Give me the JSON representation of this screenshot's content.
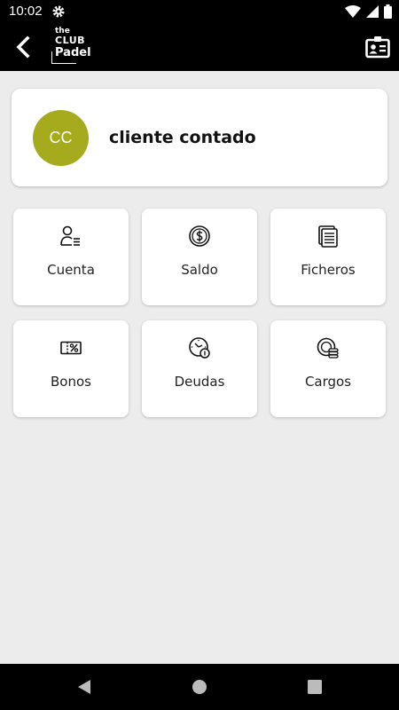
{
  "status_bar": {
    "time": "10:02"
  },
  "app_bar": {
    "logo": {
      "line1": "the",
      "line2": "CLUB",
      "line3": "Padel"
    }
  },
  "profile": {
    "initials": "CC",
    "name": "cliente contado",
    "avatar_color": "#a5ab1c"
  },
  "tiles": [
    {
      "label": "Cuenta",
      "icon": "user-list-icon"
    },
    {
      "label": "Saldo",
      "icon": "dollar-coin-icon"
    },
    {
      "label": "Ficheros",
      "icon": "documents-icon"
    },
    {
      "label": "Bonos",
      "icon": "ticket-percent-icon"
    },
    {
      "label": "Deudas",
      "icon": "clock-coin-icon"
    },
    {
      "label": "Cargos",
      "icon": "coins-stack-icon"
    }
  ]
}
